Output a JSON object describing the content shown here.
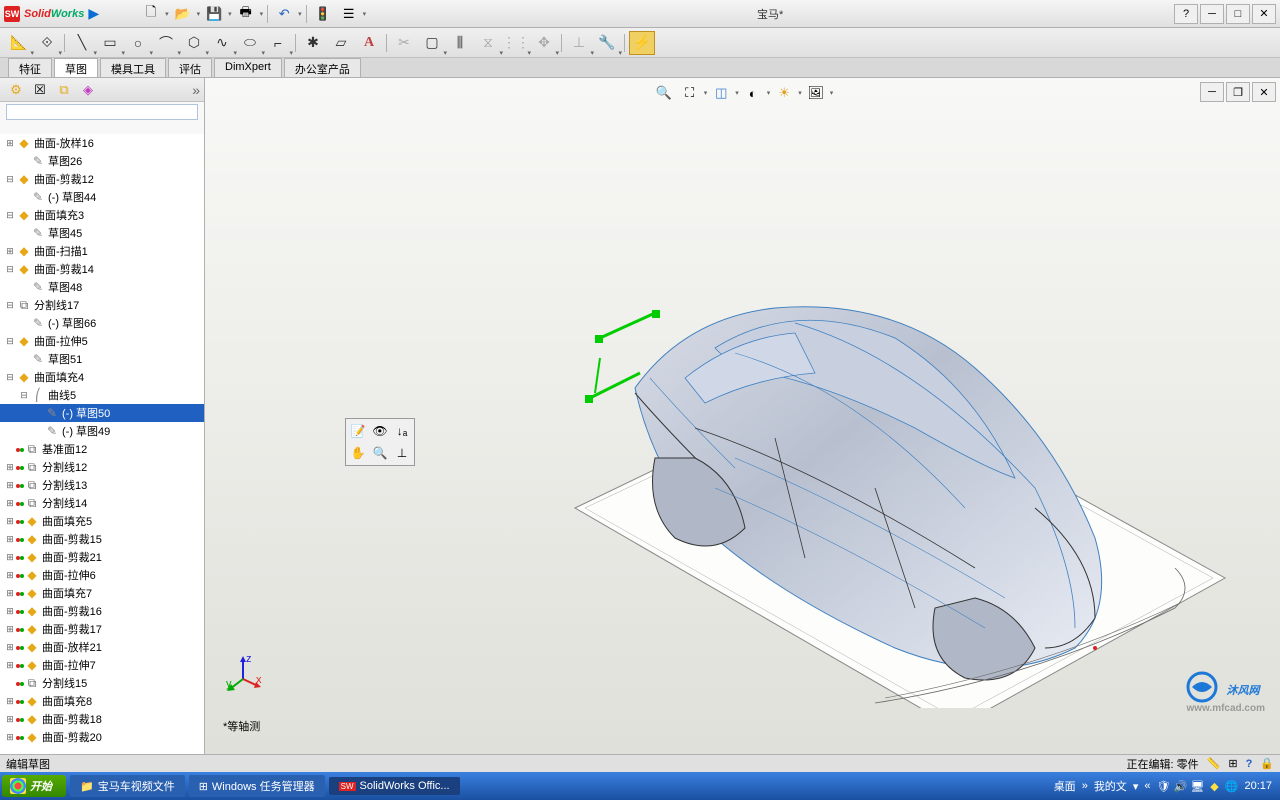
{
  "title": {
    "brand_s": "Solid",
    "brand_w": "Works",
    "document": "宝马*"
  },
  "winctrl": {
    "help": "?",
    "min": "─",
    "max": "□",
    "close": "✕"
  },
  "tabs": [
    "特征",
    "草图",
    "模具工具",
    "评估",
    "DimXpert",
    "办公室产品"
  ],
  "active_tab_index": 1,
  "tree": [
    {
      "t": "曲面-放样16",
      "ic": "surf",
      "exp": "+",
      "lvl": 0
    },
    {
      "t": "草图26",
      "ic": "sketch",
      "lvl": 1
    },
    {
      "t": "曲面-剪裁12",
      "ic": "surf",
      "exp": "-",
      "lvl": 0
    },
    {
      "t": "(-) 草图44",
      "ic": "sketch",
      "lvl": 1
    },
    {
      "t": "曲面填充3",
      "ic": "surf",
      "exp": "-",
      "lvl": 0
    },
    {
      "t": "草图45",
      "ic": "sketch",
      "lvl": 1
    },
    {
      "t": "曲面-扫描1",
      "ic": "surf",
      "exp": "+",
      "lvl": 0
    },
    {
      "t": "曲面-剪裁14",
      "ic": "surf",
      "exp": "-",
      "lvl": 0
    },
    {
      "t": "草图48",
      "ic": "sketch",
      "lvl": 1
    },
    {
      "t": "分割线17",
      "ic": "split",
      "exp": "-",
      "lvl": 0
    },
    {
      "t": "(-) 草图66",
      "ic": "sketch",
      "lvl": 1
    },
    {
      "t": "曲面-拉伸5",
      "ic": "surf",
      "exp": "-",
      "lvl": 0
    },
    {
      "t": "草图51",
      "ic": "sketch",
      "lvl": 1
    },
    {
      "t": "曲面填充4",
      "ic": "surf",
      "exp": "-",
      "lvl": 0
    },
    {
      "t": "曲线5",
      "ic": "curve",
      "exp": "-",
      "lvl": 1
    },
    {
      "t": "(-) 草图50",
      "ic": "sketch",
      "lvl": 2,
      "sel": true
    },
    {
      "t": "(-) 草图49",
      "ic": "sketch",
      "lvl": 2
    },
    {
      "t": "基准面12",
      "ic": "split",
      "lvl": 0,
      "sup": true
    },
    {
      "t": "分割线12",
      "ic": "split",
      "exp": "+",
      "lvl": 0,
      "sup": true
    },
    {
      "t": "分割线13",
      "ic": "split",
      "exp": "+",
      "lvl": 0,
      "sup": true
    },
    {
      "t": "分割线14",
      "ic": "split",
      "exp": "+",
      "lvl": 0,
      "sup": true
    },
    {
      "t": "曲面填充5",
      "ic": "surf",
      "exp": "+",
      "lvl": 0,
      "sup": true
    },
    {
      "t": "曲面-剪裁15",
      "ic": "surf",
      "exp": "+",
      "lvl": 0,
      "sup": true
    },
    {
      "t": "曲面-剪裁21",
      "ic": "surf",
      "exp": "+",
      "lvl": 0,
      "sup": true
    },
    {
      "t": "曲面-拉伸6",
      "ic": "surf",
      "exp": "+",
      "lvl": 0,
      "sup": true
    },
    {
      "t": "曲面填充7",
      "ic": "surf",
      "exp": "+",
      "lvl": 0,
      "sup": true
    },
    {
      "t": "曲面-剪裁16",
      "ic": "surf",
      "exp": "+",
      "lvl": 0,
      "sup": true
    },
    {
      "t": "曲面-剪裁17",
      "ic": "surf",
      "exp": "+",
      "lvl": 0,
      "sup": true
    },
    {
      "t": "曲面-放样21",
      "ic": "surf",
      "exp": "+",
      "lvl": 0,
      "sup": true
    },
    {
      "t": "曲面-拉伸7",
      "ic": "surf",
      "exp": "+",
      "lvl": 0,
      "sup": true
    },
    {
      "t": "分割线15",
      "ic": "split",
      "lvl": 0,
      "sup": true
    },
    {
      "t": "曲面填充8",
      "ic": "surf",
      "exp": "+",
      "lvl": 0,
      "sup": true
    },
    {
      "t": "曲面-剪裁18",
      "ic": "surf",
      "exp": "+",
      "lvl": 0,
      "sup": true
    },
    {
      "t": "曲面-剪裁20",
      "ic": "surf",
      "exp": "+",
      "lvl": 0,
      "sup": true
    }
  ],
  "vp_orient": "*等轴测",
  "status": {
    "left": "编辑草图",
    "right": "正在编辑: 零件"
  },
  "watermark": {
    "text": "沐风网",
    "url": "www.mfcad.com"
  },
  "taskbar": {
    "start": "开始",
    "items": [
      "宝马车视频文件",
      "Windows 任务管理器",
      "SolidWorks Offic..."
    ],
    "tray": {
      "labels": [
        "桌面",
        "我的文"
      ],
      "clock": "20:17"
    }
  }
}
